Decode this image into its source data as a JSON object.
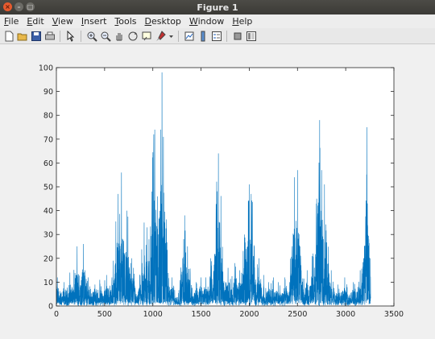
{
  "window": {
    "title": "Figure 1"
  },
  "menu": [
    {
      "pre": "",
      "u": "F",
      "post": "ile"
    },
    {
      "pre": "",
      "u": "E",
      "post": "dit"
    },
    {
      "pre": "",
      "u": "V",
      "post": "iew"
    },
    {
      "pre": "",
      "u": "I",
      "post": "nsert"
    },
    {
      "pre": "",
      "u": "T",
      "post": "ools"
    },
    {
      "pre": "",
      "u": "D",
      "post": "esktop"
    },
    {
      "pre": "",
      "u": "W",
      "post": "indow"
    },
    {
      "pre": "",
      "u": "H",
      "post": "elp"
    }
  ],
  "toolbar": {
    "icons": [
      "new-figure-icon",
      "open-file-icon",
      "save-icon",
      "print-icon",
      "select-arrow-icon",
      "zoom-in-icon",
      "zoom-out-icon",
      "pan-hand-icon",
      "rotate-3d-icon",
      "data-cursor-icon",
      "brush-icon",
      "dropdown-arrow-icon",
      "link-plot-icon",
      "insert-colorbar-icon",
      "insert-legend-icon",
      "hide-plot-tools-icon",
      "show-plot-tools-icon"
    ]
  },
  "chart_data": {
    "type": "line",
    "title": "",
    "xlabel": "",
    "ylabel": "",
    "xlim": [
      0,
      3500
    ],
    "ylim": [
      0,
      100
    ],
    "xticks": [
      0,
      500,
      1000,
      1500,
      2000,
      2500,
      3000,
      3500
    ],
    "yticks": [
      0,
      10,
      20,
      30,
      40,
      50,
      60,
      70,
      80,
      90,
      100
    ],
    "grid": false,
    "line_color": "#0072bd",
    "peaks": [
      [
        10,
        12
      ],
      [
        80,
        10
      ],
      [
        140,
        14
      ],
      [
        215,
        25
      ],
      [
        280,
        26
      ],
      [
        330,
        12
      ],
      [
        400,
        9
      ],
      [
        450,
        11
      ],
      [
        520,
        13
      ],
      [
        590,
        19
      ],
      [
        640,
        47
      ],
      [
        675,
        56
      ],
      [
        730,
        40
      ],
      [
        780,
        20
      ],
      [
        910,
        35
      ],
      [
        940,
        33
      ],
      [
        960,
        28
      ],
      [
        990,
        48
      ],
      [
        1010,
        72
      ],
      [
        1020,
        74
      ],
      [
        1050,
        46
      ],
      [
        1080,
        74
      ],
      [
        1095,
        98
      ],
      [
        1110,
        71
      ],
      [
        1125,
        35
      ],
      [
        1200,
        12
      ],
      [
        1310,
        20
      ],
      [
        1330,
        38
      ],
      [
        1360,
        25
      ],
      [
        1450,
        10
      ],
      [
        1500,
        12
      ],
      [
        1550,
        12
      ],
      [
        1600,
        20
      ],
      [
        1640,
        18
      ],
      [
        1680,
        64
      ],
      [
        1720,
        15
      ],
      [
        1780,
        16
      ],
      [
        1850,
        18
      ],
      [
        1900,
        15
      ],
      [
        1950,
        30
      ],
      [
        1990,
        44
      ],
      [
        2000,
        51
      ],
      [
        2020,
        47
      ],
      [
        2050,
        25
      ],
      [
        2100,
        20
      ],
      [
        2150,
        13
      ],
      [
        2200,
        10
      ],
      [
        2250,
        12
      ],
      [
        2300,
        10
      ],
      [
        2370,
        12
      ],
      [
        2420,
        10
      ],
      [
        2470,
        54
      ],
      [
        2500,
        57
      ],
      [
        2530,
        20
      ],
      [
        2600,
        15
      ],
      [
        2660,
        22
      ],
      [
        2700,
        33
      ],
      [
        2730,
        78
      ],
      [
        2750,
        57
      ],
      [
        2780,
        51
      ],
      [
        2810,
        12
      ],
      [
        2850,
        15
      ],
      [
        2920,
        9
      ],
      [
        2990,
        12
      ],
      [
        3080,
        10
      ],
      [
        3150,
        15
      ],
      [
        3200,
        20
      ],
      [
        3220,
        75
      ],
      [
        3240,
        28
      ],
      [
        3255,
        20
      ]
    ],
    "n_points": 3260
  }
}
